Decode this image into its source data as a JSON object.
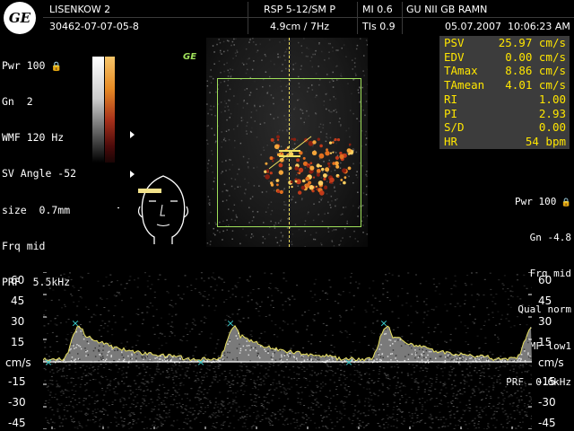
{
  "header": {
    "logo": "GE",
    "patient_name": "LISENKOW 2",
    "patient_id": "30462-07-07-05-8",
    "probe": "RSP 5-12/SM P",
    "depth_freq": "4.9cm / 7Hz",
    "mi": "MI  0.6",
    "tis": "TIs  0.9",
    "institution": "GU NII GB RAMN",
    "date": "05.07.2007",
    "time": "10:06:23 AM"
  },
  "left_params": [
    "Pwr 100",
    "Gn  2",
    "WMF 120 Hz",
    "SV Angle -52",
    "size  0.7mm",
    "Frq mid",
    "PRF  5.5kHz"
  ],
  "image_mark": "GE",
  "measurements": [
    {
      "key": "PSV",
      "value": "25.97 cm/s"
    },
    {
      "key": "EDV",
      "value": "0.00 cm/s"
    },
    {
      "key": "TAmax",
      "value": "8.86 cm/s"
    },
    {
      "key": "TAmean",
      "value": "4.01 cm/s"
    },
    {
      "key": "RI",
      "value": "1.00"
    },
    {
      "key": "PI",
      "value": "2.93"
    },
    {
      "key": "S/D",
      "value": "0.00"
    },
    {
      "key": "HR",
      "value": "54 bpm"
    }
  ],
  "right_params": [
    "Pwr 100",
    "Gn -4.8",
    "Frq mid",
    "Qual norm",
    "WMF low1",
    "PRF  0.6kHz"
  ],
  "spectral": {
    "scale_labels": [
      "60",
      "45",
      "30",
      "15",
      "cm/s",
      "-15",
      "-30",
      "-45"
    ],
    "scale_values": [
      60,
      45,
      30,
      15,
      0,
      -15,
      -30,
      -45
    ],
    "range": [
      -45,
      60
    ],
    "peak_velocity": 25.97,
    "heart_rate": 54
  },
  "colors": {
    "measure_text": "#ffe600",
    "measure_bg": "#3c3c3c",
    "roi_box": "#9fe05a",
    "cursor": "#f0e060",
    "envelope": "#e8e060",
    "marker": "#3ad0d0"
  }
}
